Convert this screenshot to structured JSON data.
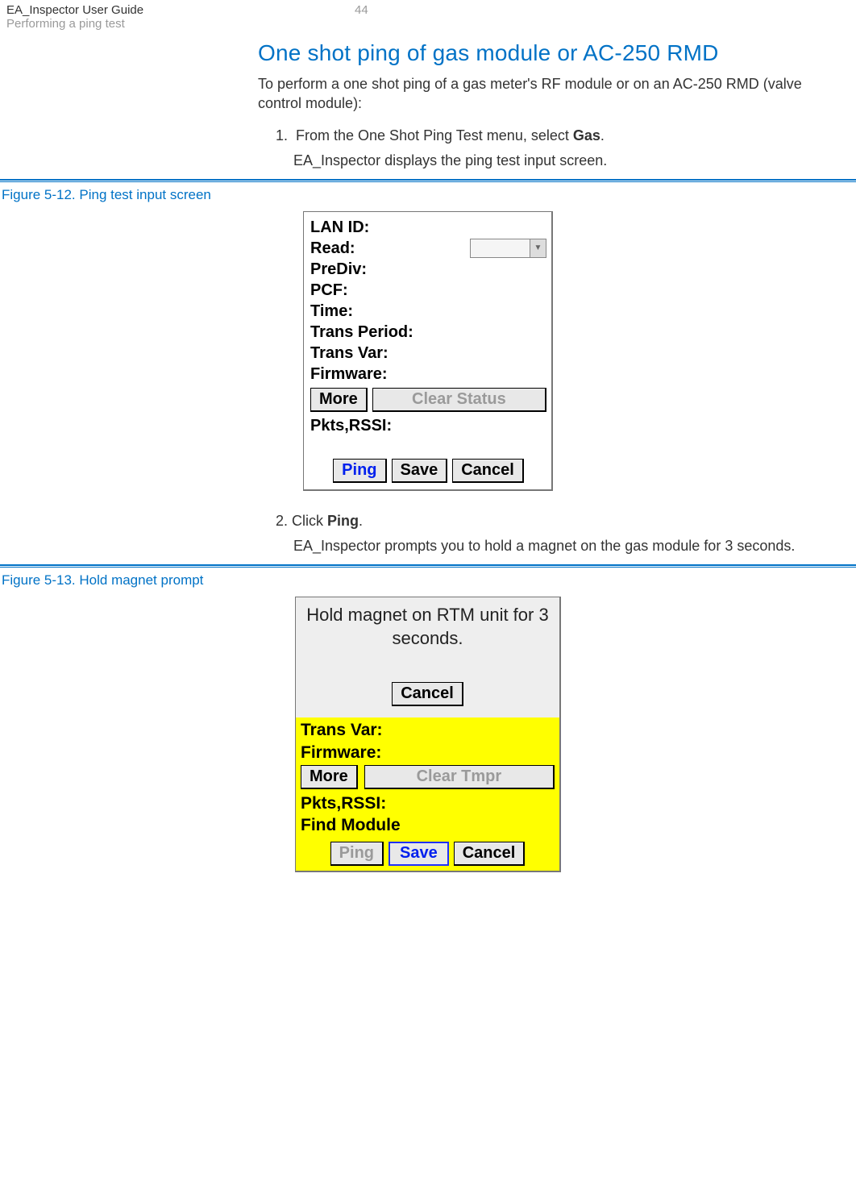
{
  "header": {
    "title": "EA_Inspector User Guide",
    "subtitle": "Performing a ping test",
    "pageNumber": "44"
  },
  "section": {
    "heading": "One shot ping of gas module or AC-250 RMD",
    "intro": "To perform a one shot ping of a gas meter's RF module or on an AC-250 RMD (valve control module):",
    "step1_num": "1.",
    "step1_text_a": "From the One Shot Ping Test menu, select ",
    "step1_text_b": "Gas",
    "step1_text_c": ".",
    "step1_sub": "EA_Inspector displays the ping test input screen.",
    "step2_num": "2.",
    "step2_text_a": "Click ",
    "step2_text_b": "Ping",
    "step2_text_c": ".",
    "step2_sub": "EA_Inspector prompts you to hold a magnet on the gas module for 3 seconds."
  },
  "figure1": {
    "caption": "Figure 5-12. Ping test input screen",
    "labels": {
      "lanId": "LAN ID:",
      "read": "Read:",
      "prediv": "PreDiv:",
      "pcf": "PCF:",
      "time": "Time:",
      "transPeriod": "Trans Period:",
      "transVar": "Trans Var:",
      "firmware": "Firmware:",
      "pktsRssi": "Pkts,RSSI:"
    },
    "buttons": {
      "more": "More",
      "clearStatus": "Clear Status",
      "ping": "Ping",
      "save": "Save",
      "cancel": "Cancel"
    }
  },
  "figure2": {
    "caption": "Figure 5-13. Hold magnet prompt",
    "dialog": {
      "message": "Hold magnet on RTM unit for 3 seconds.",
      "cancel": "Cancel"
    },
    "labels": {
      "transVar": "Trans Var:",
      "firmware": "Firmware:",
      "pktsRssi": "Pkts,RSSI:",
      "findModule": "Find Module"
    },
    "buttons": {
      "more": "More",
      "clearTmpr": "Clear Tmpr",
      "ping": "Ping",
      "save": "Save",
      "cancel": "Cancel"
    }
  }
}
